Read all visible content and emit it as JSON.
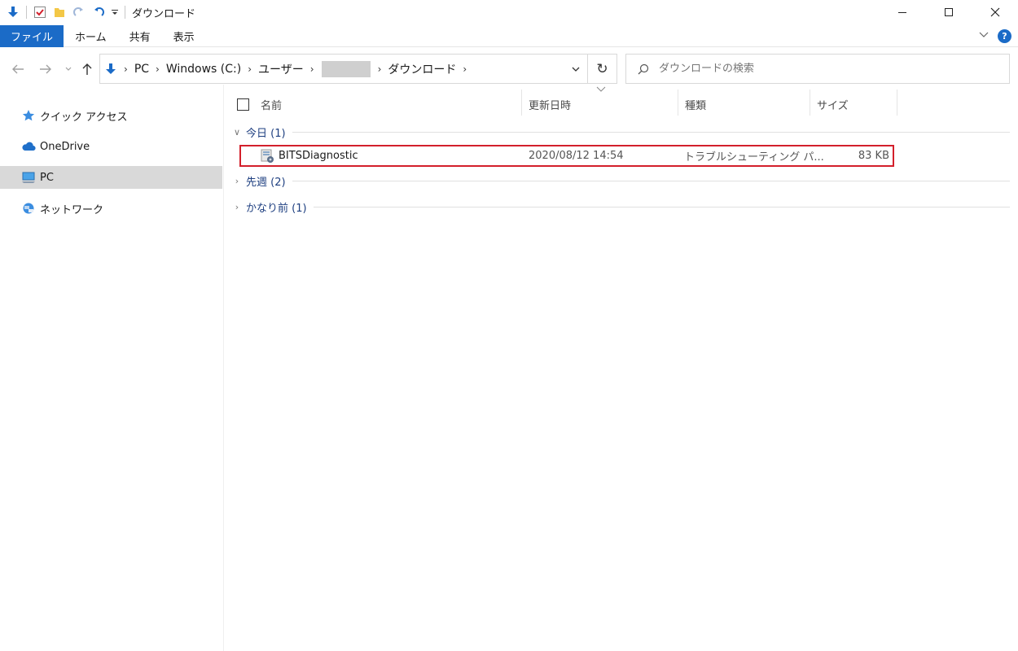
{
  "window": {
    "title": "ダウンロード"
  },
  "quick_access_toolbar": {
    "icons": [
      "download-arrow-icon",
      "properties-check-icon",
      "new-folder-icon",
      "redo-icon",
      "undo-icon",
      "customize-dropdown-icon"
    ]
  },
  "ribbon": {
    "tabs": [
      {
        "label": "ファイル",
        "active": true
      },
      {
        "label": "ホーム"
      },
      {
        "label": "共有"
      },
      {
        "label": "表示"
      }
    ],
    "help_label": "?"
  },
  "address": {
    "breadcrumbs": [
      "PC",
      "Windows (C:)",
      "ユーザー",
      "ダウンロード"
    ],
    "search_placeholder": "ダウンロードの検索"
  },
  "nav_pane": {
    "items": [
      {
        "label": "クイック アクセス",
        "icon": "star-icon"
      },
      {
        "label": "OneDrive",
        "icon": "cloud-icon"
      },
      {
        "label": "PC",
        "icon": "computer-icon",
        "selected": true
      },
      {
        "label": "ネットワーク",
        "icon": "network-icon"
      }
    ]
  },
  "columns": {
    "name": "名前",
    "date": "更新日時",
    "type": "種類",
    "size": "サイズ"
  },
  "groups": [
    {
      "label": "今日 (1)",
      "expanded": true
    },
    {
      "label": "先週 (2)",
      "expanded": false
    },
    {
      "label": "かなり前 (1)",
      "expanded": false
    }
  ],
  "files": [
    {
      "name": "BITSDiagnostic",
      "date": "2020/08/12 14:54",
      "type": "トラブルシューティング パ...",
      "size": "83 KB"
    }
  ],
  "colors": {
    "accent": "#1b6bc7",
    "highlight_border": "#d31f2b",
    "selected_nav": "#d9d9d9",
    "group_label": "#1e3f80"
  }
}
